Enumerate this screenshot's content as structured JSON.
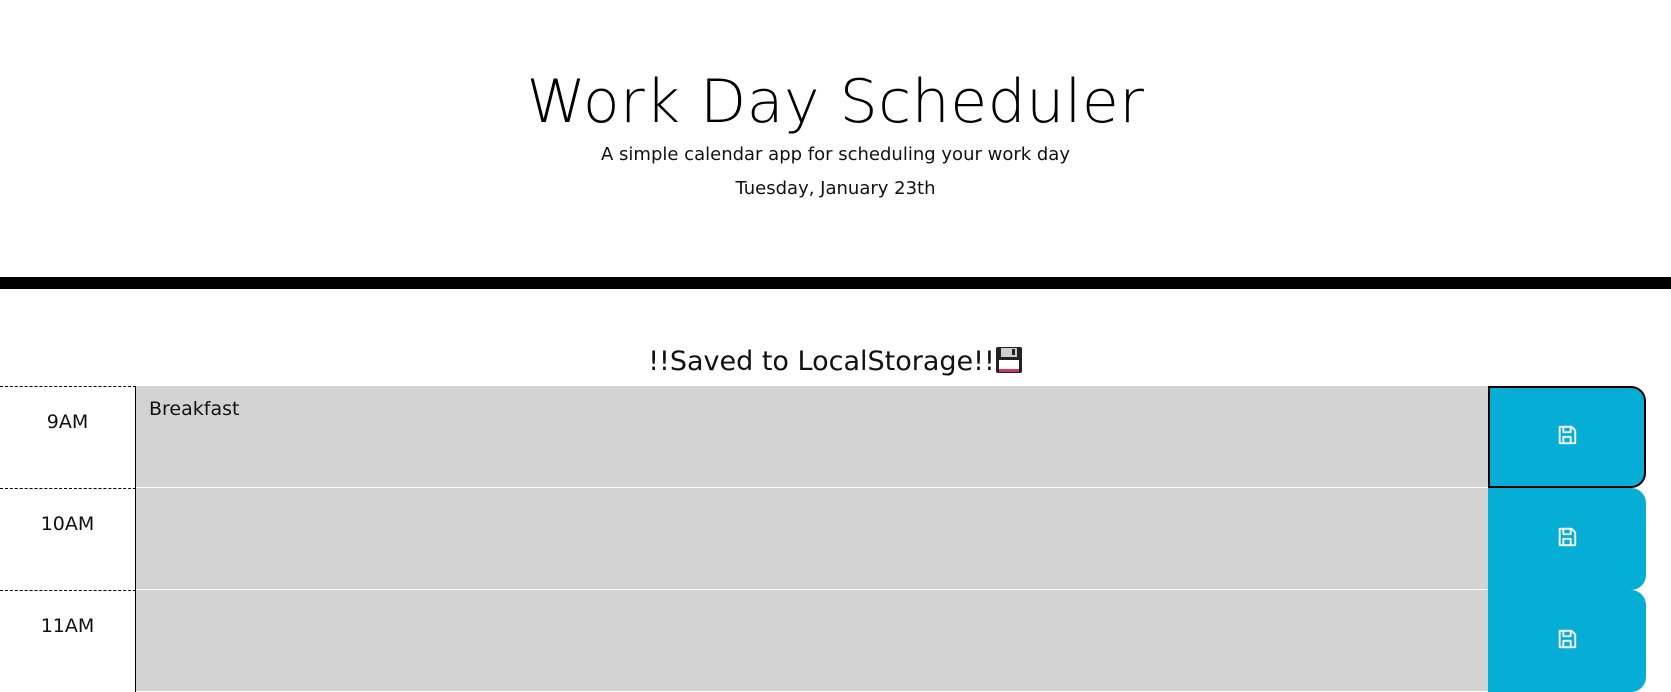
{
  "header": {
    "title": "Work Day Scheduler",
    "subtitle": "A simple calendar app for scheduling your work day",
    "current_day": "Tuesday, January 23th"
  },
  "notice": {
    "text": "!!Saved to LocalStorage!!",
    "icon": "floppy-disk-emoji"
  },
  "rows": [
    {
      "hour": "9AM",
      "text": "Breakfast"
    },
    {
      "hour": "10AM",
      "text": ""
    },
    {
      "hour": "11AM",
      "text": ""
    }
  ],
  "colors": {
    "past": "#d3d3d3",
    "save_button": "#06aed5",
    "header_border": "#000000"
  },
  "icons": {
    "save": "save-icon"
  }
}
